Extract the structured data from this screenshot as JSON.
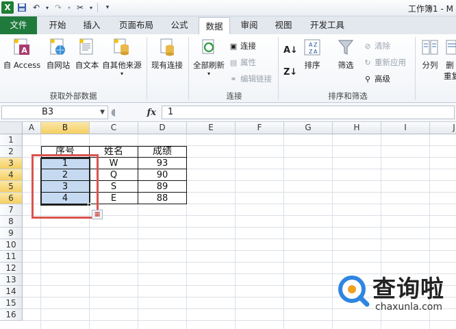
{
  "window": {
    "title": "工作簿1 - M"
  },
  "tabs": [
    "文件",
    "开始",
    "插入",
    "页面布局",
    "公式",
    "数据",
    "审阅",
    "视图",
    "开发工具"
  ],
  "active_tab": "数据",
  "ribbon": {
    "get_external": {
      "label": "获取外部数据",
      "buttons": [
        "自 Access",
        "自网站",
        "自文本",
        "自其他来源"
      ]
    },
    "existing_conn": "现有连接",
    "connections": {
      "label": "连接",
      "refresh_all": "全部刷新",
      "connect": "连接",
      "properties": "属性",
      "edit_links": "编辑链接"
    },
    "sort_filter": {
      "label": "排序和筛选",
      "sort": "排序",
      "filter": "筛选",
      "clear": "清除",
      "reapply": "重新应用",
      "advanced": "高级"
    },
    "data_tools": {
      "split": "分列",
      "remove": "删",
      "repeat": "重复"
    }
  },
  "formula_bar": {
    "name_box": "B3",
    "fx": "fx",
    "formula": "1"
  },
  "columns": [
    "A",
    "B",
    "C",
    "D",
    "E",
    "F",
    "G",
    "H",
    "I",
    "J"
  ],
  "rows": [
    "1",
    "2",
    "3",
    "4",
    "5",
    "6",
    "7",
    "8",
    "9",
    "10",
    "11",
    "12",
    "13",
    "14",
    "15",
    "16"
  ],
  "table": {
    "headers": [
      "序号",
      "姓名",
      "成绩"
    ],
    "rows": [
      [
        "1",
        "W",
        "93"
      ],
      [
        "2",
        "Q",
        "90"
      ],
      [
        "3",
        "S",
        "89"
      ],
      [
        "4",
        "E",
        "88"
      ]
    ]
  },
  "watermark": {
    "text": "查询啦",
    "url": "chaxunla.com"
  },
  "colors": {
    "file_tab": "#1f7a3c",
    "selection": "#c5daf1",
    "highlight_box": "#d9534f",
    "watermark_accent": "#2f86e0"
  }
}
